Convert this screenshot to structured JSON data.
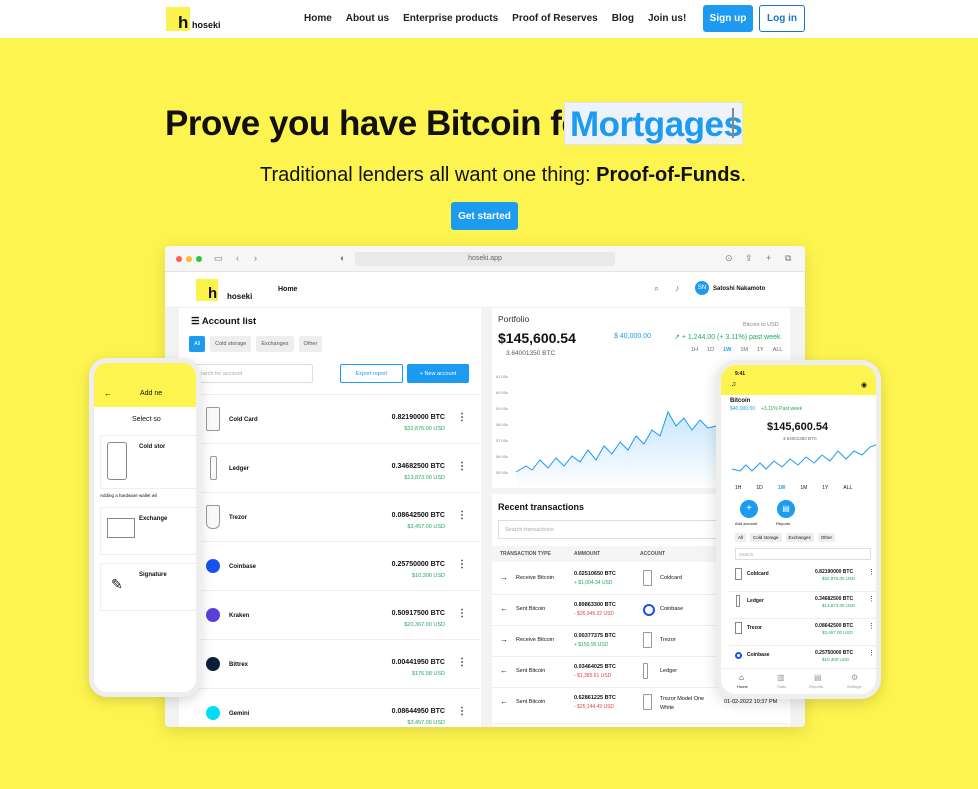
{
  "nav": {
    "logo_text": "hoseki",
    "logo_letter": "h",
    "links": [
      "Home",
      "About us",
      "Enterprise products",
      "Proof of Reserves",
      "Blog",
      "Join us!"
    ],
    "signup": "Sign up",
    "login": "Log in"
  },
  "hero": {
    "headline": "Prove you have Bitcoin for",
    "highlight": "Mortgages",
    "sub_prefix": "Traditional lenders all want one thing:",
    "sub_bold": "Proof-of-Funds",
    "sub_suffix": ".",
    "cta": "Get started"
  },
  "browser": {
    "url": "hoseki.app",
    "app_logo_text": "hoseki",
    "app_home": "Home",
    "user_initials": "SN",
    "user_name": "Satoshi Nakamoto"
  },
  "account_list": {
    "title": "Account list",
    "filters": [
      "All",
      "Cold storage",
      "Exchanges",
      "Other"
    ],
    "search_placeholder": "Search for account",
    "export": "Export report",
    "new_account": "+ New account",
    "rows": [
      {
        "name": "Cold Card",
        "btc": "0.82190000 BTC",
        "usd": "$32,876.00 USD"
      },
      {
        "name": "Ledger",
        "btc": "0.34682500 BTC",
        "usd": "$13,873.00 USD"
      },
      {
        "name": "Trezor",
        "btc": "0.08642500 BTC",
        "usd": "$3,457.00 USD"
      },
      {
        "name": "Coinbase",
        "btc": "0.25750000 BTC",
        "usd": "$10,300 USD"
      },
      {
        "name": "Kraken",
        "btc": "0.50917500 BTC",
        "usd": "$20,367.00 USD"
      },
      {
        "name": "Bittrex",
        "btc": "0.00441950 BTC",
        "usd": "$176.58 USD"
      },
      {
        "name": "Gemini",
        "btc": "0.08644950 BTC",
        "usd": "$3,457.00 USD"
      }
    ]
  },
  "portfolio": {
    "label": "Portfolio",
    "value": "$145,600.54",
    "btc": "3.64001350 BTC",
    "usd_line": "$ 40,000.00",
    "change": "+ 1,244.00 (+ 3.11%) past week",
    "pair": "Bitcoin to USD",
    "ranges": [
      "1H",
      "1D",
      "1W",
      "1M",
      "1Y",
      "ALL"
    ],
    "y_ticks": [
      "61.00k",
      "60.00k",
      "59.00k",
      "58.00k",
      "57.00k",
      "56.00k",
      "55.00k"
    ]
  },
  "recent": {
    "title": "Recent transactions",
    "search_placeholder": "Search transactions",
    "headers": [
      "TRANSACTION TYPE",
      "AMMOUNT",
      "ACCOUNT"
    ],
    "rows": [
      {
        "arrow": "→",
        "type": "Receive Bitcoin",
        "btc": "0.02510650 BTC",
        "usd": "+ $1,004.34 USD",
        "account": "Coldcard"
      },
      {
        "arrow": "←",
        "type": "Sent Bitcoin",
        "btc": "0.89863300 BTC",
        "usd": "- $35,945.32 USD",
        "account": "Coinbase"
      },
      {
        "arrow": "→",
        "type": "Receive Bitcoin",
        "btc": "0.00377375 BTC",
        "usd": "+ $150.95 USD",
        "account": "Trezor"
      },
      {
        "arrow": "←",
        "type": "Sent Bitcoin",
        "btc": "0.03464025 BTC",
        "usd": "- $1,385.61 USD",
        "account": "Ledger"
      },
      {
        "arrow": "←",
        "type": "Sent Bitcoin",
        "btc": "0.62861225 BTC",
        "usd": "- $25,144.49 USD",
        "account": "Trezor Model One White",
        "date": "01-02-2022 10:37 PM"
      }
    ]
  },
  "phone_left": {
    "title": "Add ne",
    "select": "Select so",
    "items": [
      "Cold stor",
      "Exchange",
      "Signature"
    ],
    "note": "Adding a hardware wallet wil"
  },
  "phone_right": {
    "time": "9:41",
    "asset": "Bitcoin",
    "asset_usd": "$40,000.00",
    "asset_change": "+3.11% Past week",
    "value": "$145,600.54",
    "btc": "3.64001350 BTC",
    "ranges": [
      "1H",
      "1D",
      "1W",
      "1M",
      "1Y",
      "ALL"
    ],
    "add_account": "Add account",
    "reports": "Reports",
    "filters": [
      "All",
      "Cold storage",
      "Exchanges",
      "Other"
    ],
    "search": "Search",
    "rows": [
      {
        "name": "Coldcard",
        "btc": "0.82190000 BTC",
        "usd": "$32,876.00 USD"
      },
      {
        "name": "Ledger",
        "btc": "0.34682500 BTC",
        "usd": "$13,873.00 USD"
      },
      {
        "name": "Trezor",
        "btc": "0.08642500 BTC",
        "usd": "$3,457.00 USD"
      },
      {
        "name": "Coinbase",
        "btc": "0.25750000 BTC",
        "usd": "$10,300 USD"
      }
    ],
    "tabs": [
      "Home",
      "Stats",
      "Reports",
      "Settings"
    ]
  },
  "colors": {
    "brand_yellow": "#fdf44f",
    "accent_blue": "#1d9bf0",
    "positive": "#1eaa5e",
    "negative": "#e0443e"
  }
}
